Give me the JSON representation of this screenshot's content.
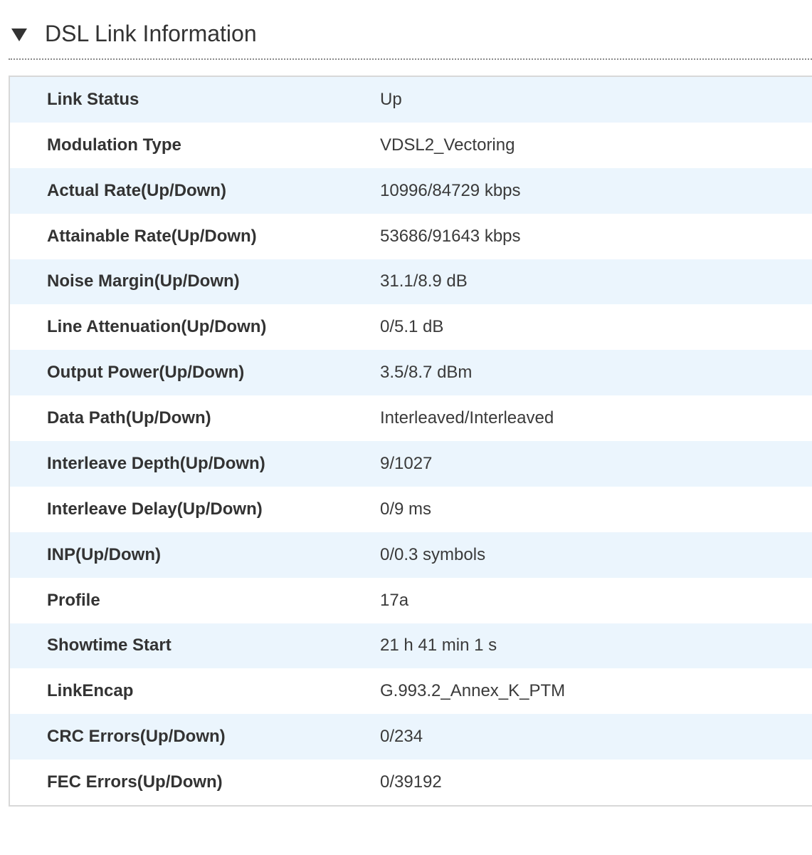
{
  "section": {
    "title": "DSL Link Information",
    "icon": "triangle-down-icon"
  },
  "table": {
    "rows": [
      {
        "label": "Link Status",
        "value": "Up"
      },
      {
        "label": "Modulation Type",
        "value": "VDSL2_Vectoring"
      },
      {
        "label": "Actual Rate(Up/Down)",
        "value": "10996/84729 kbps"
      },
      {
        "label": "Attainable Rate(Up/Down)",
        "value": "53686/91643 kbps"
      },
      {
        "label": "Noise Margin(Up/Down)",
        "value": "31.1/8.9 dB"
      },
      {
        "label": "Line Attenuation(Up/Down)",
        "value": "0/5.1 dB"
      },
      {
        "label": "Output Power(Up/Down)",
        "value": "3.5/8.7 dBm"
      },
      {
        "label": "Data Path(Up/Down)",
        "value": "Interleaved/Interleaved"
      },
      {
        "label": "Interleave Depth(Up/Down)",
        "value": "9/1027"
      },
      {
        "label": "Interleave Delay(Up/Down)",
        "value": "0/9 ms"
      },
      {
        "label": "INP(Up/Down)",
        "value": "0/0.3 symbols"
      },
      {
        "label": "Profile",
        "value": "17a"
      },
      {
        "label": "Showtime Start",
        "value": "21 h 41 min 1 s"
      },
      {
        "label": "LinkEncap",
        "value": "G.993.2_Annex_K_PTM"
      },
      {
        "label": "CRC Errors(Up/Down)",
        "value": "0/234"
      },
      {
        "label": "FEC Errors(Up/Down)",
        "value": "0/39192"
      }
    ]
  },
  "colors": {
    "row_alt": "#ebf5fd",
    "row_base": "#ffffff",
    "border": "#d8d8d8",
    "text": "#333333"
  }
}
